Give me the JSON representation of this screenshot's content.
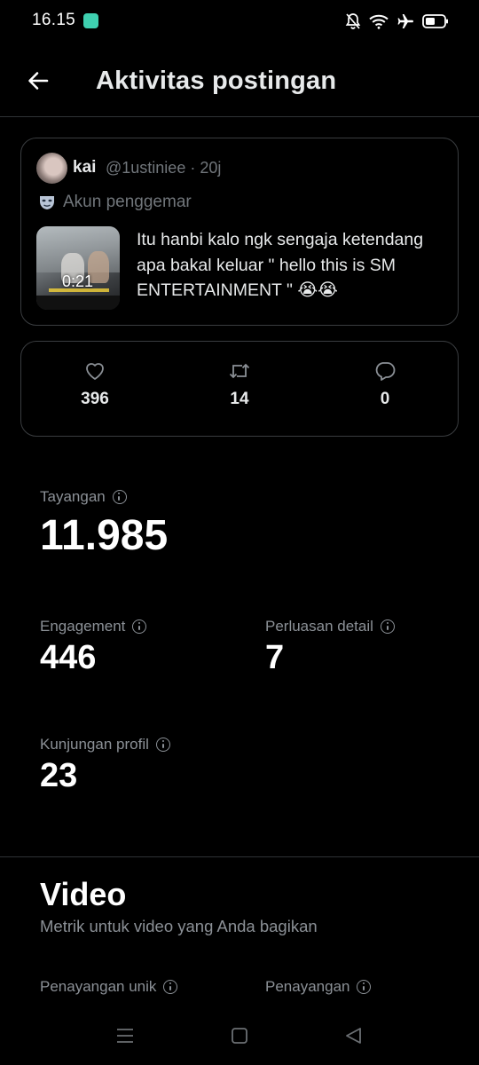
{
  "status_bar": {
    "time": "16.15",
    "icons": [
      "app-notification-icon",
      "mute-bell-icon",
      "wifi-icon",
      "airplane-icon",
      "battery-icon"
    ]
  },
  "header": {
    "back_icon": "arrow-left-icon",
    "title": "Aktivitas postingan"
  },
  "post": {
    "name": "kai",
    "handle_time": "@1ustiniee · 20j",
    "fan_label": "Akun penggemar",
    "fan_icon": "mask-icon",
    "video_duration": "0:21",
    "text": "Itu hanbi kalo ngk sengaja ketendang apa bakal keluar \" hello this is SM ENTERTAINMENT \" 😭😭"
  },
  "engagement": {
    "likes": "396",
    "reposts": "14",
    "replies": "0",
    "icons": [
      "heart-icon",
      "repost-icon",
      "reply-icon"
    ]
  },
  "metrics": {
    "views_label": "Tayangan",
    "views_value": "11.985",
    "engagement_label": "Engagement",
    "engagement_value": "446",
    "detail_label": "Perluasan detail",
    "detail_value": "7",
    "profile_label": "Kunjungan profil",
    "profile_value": "23"
  },
  "video_section": {
    "title": "Video",
    "subtitle": "Metrik untuk video yang Anda bagikan",
    "unique_views_label": "Penayangan unik",
    "views_label": "Penayangan"
  },
  "colors": {
    "background": "#000000",
    "text_primary": "#e7e9ea",
    "text_secondary": "#71767b",
    "border": "#2f3336"
  }
}
